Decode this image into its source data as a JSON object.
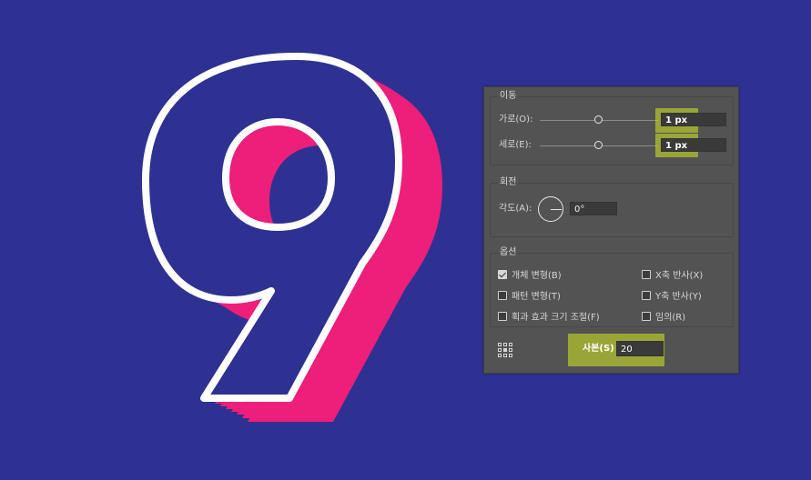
{
  "artwork": {
    "glyph": "9",
    "glyph_icon": "nine-numeral-3d-artwork",
    "fill_color": "#ed1f7a",
    "outline_color": "#ffffff",
    "background_color": "#2e3191"
  },
  "move": {
    "legend": "이동",
    "horizontal_label": "가로(O):",
    "horizontal_value": "1 px",
    "horizontal_slider_level": 0.5,
    "vertical_label": "세로(E):",
    "vertical_value": "1 px",
    "vertical_slider_level": 0.5
  },
  "rotate": {
    "legend": "회전",
    "angle_label": "각도(A):",
    "angle_value": "0°",
    "dial_icon": "angle-dial-icon"
  },
  "options": {
    "legend": "옵션",
    "transform_objects": {
      "label": "개체 변형(B)",
      "checked": true
    },
    "transform_patterns": {
      "label": "패턴 변형(T)",
      "checked": false
    },
    "scale_strokes": {
      "label": "획과 효과 크기 조절(F)",
      "checked": false
    },
    "reflect_x": {
      "label": "X축 반사(X)",
      "checked": false
    },
    "reflect_y": {
      "label": "Y축 반사(Y)",
      "checked": false
    },
    "random": {
      "label": "임의(R)",
      "checked": false
    }
  },
  "copies": {
    "label": "사본(S)",
    "value": "20",
    "reference_point_icon": "reference-point-grid-icon"
  },
  "highlight_color": "#c6d828"
}
